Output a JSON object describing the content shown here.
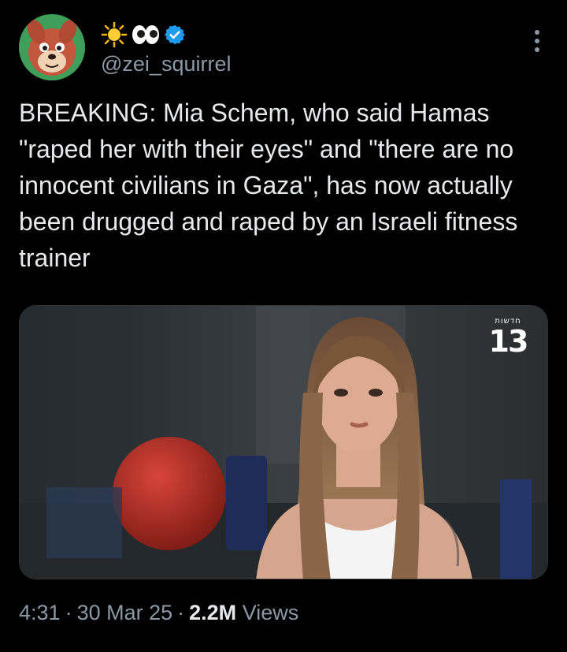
{
  "author": {
    "display_name_emojis": [
      "sun-emoji",
      "eyes-emoji"
    ],
    "verified_icon": "verified-badge-icon",
    "handle": "@zei_squirrel",
    "avatar_icon": "squirrel-avatar"
  },
  "tweet": {
    "text": "BREAKING: Mia Schem, who said Hamas \"raped her with their eyes\" and \"there are no innocent civilians in Gaza\", has now actually been drugged and raped by an Israeli fitness trainer"
  },
  "media": {
    "logo_caption": "חדשות",
    "logo_number": "13"
  },
  "meta": {
    "time": "4:31",
    "date": "30 Mar 25",
    "views_count": "2.2M",
    "views_label": "Views",
    "separator": "·"
  },
  "colors": {
    "background": "#000000",
    "text_primary": "#e7e9ea",
    "text_secondary": "#8b98a5",
    "verified_blue": "#1d9bf0"
  }
}
